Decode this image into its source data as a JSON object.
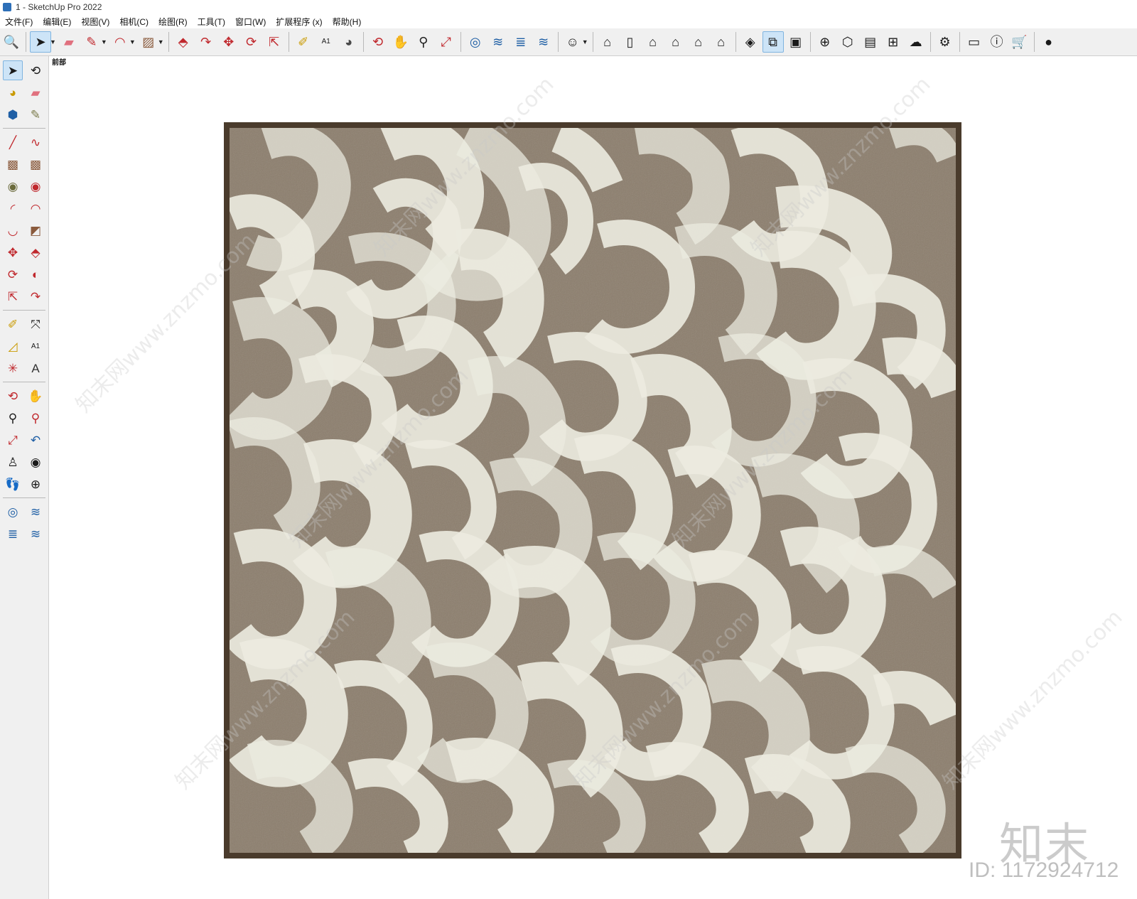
{
  "window": {
    "title": "1 - SketchUp Pro 2022"
  },
  "menu": [
    "文件(F)",
    "编辑(E)",
    "视图(V)",
    "相机(C)",
    "绘图(R)",
    "工具(T)",
    "窗口(W)",
    "扩展程序 (x)",
    "帮助(H)"
  ],
  "toolbar": {
    "groups": [
      [
        {
          "name": "search",
          "glyph": "🔍"
        }
      ],
      [
        {
          "name": "select",
          "glyph": "➤",
          "active": true,
          "dropdown": true
        },
        {
          "name": "eraser",
          "glyph": "▰",
          "color": "#e0707e"
        },
        {
          "name": "pencil-line",
          "glyph": "✎",
          "color": "#c0282d",
          "dropdown": true
        },
        {
          "name": "arc",
          "glyph": "◠",
          "color": "#c0282d",
          "dropdown": true
        },
        {
          "name": "rectangle",
          "glyph": "▨",
          "color": "#8a5a3c",
          "dropdown": true
        }
      ],
      [
        {
          "name": "push-pull",
          "glyph": "⬘",
          "color": "#c0282d"
        },
        {
          "name": "follow-me",
          "glyph": "↷",
          "color": "#c0282d"
        },
        {
          "name": "move",
          "glyph": "✥",
          "color": "#c0282d"
        },
        {
          "name": "rotate",
          "glyph": "⟳",
          "color": "#c0282d"
        },
        {
          "name": "scale",
          "glyph": "⇱",
          "color": "#c0282d"
        }
      ],
      [
        {
          "name": "tape-measure",
          "glyph": "✐",
          "color": "#c99a00"
        },
        {
          "name": "text-label",
          "glyph": "A1"
        },
        {
          "name": "paint-bucket",
          "glyph": "◕",
          "color": "#4a4a4a"
        }
      ],
      [
        {
          "name": "orbit",
          "glyph": "⟲",
          "color": "#c0282d"
        },
        {
          "name": "pan",
          "glyph": "✋",
          "color": "#e0a46c"
        },
        {
          "name": "zoom",
          "glyph": "⚲",
          "color": "#222"
        },
        {
          "name": "zoom-extents",
          "glyph": "⤢",
          "color": "#c0282d"
        }
      ],
      [
        {
          "name": "warehouse",
          "glyph": "◎",
          "color": "#1f5fa5"
        },
        {
          "name": "extension-warehouse",
          "glyph": "≋",
          "color": "#1f5fa5"
        },
        {
          "name": "layout",
          "glyph": "≣",
          "color": "#1f5fa5"
        },
        {
          "name": "extension-manager",
          "glyph": "≋",
          "color": "#1f5fa5"
        }
      ],
      [
        {
          "name": "account",
          "glyph": "☺",
          "dropdown": true
        }
      ],
      [
        {
          "name": "iso-view",
          "glyph": "⌂"
        },
        {
          "name": "top-view",
          "glyph": "▯"
        },
        {
          "name": "front-view",
          "glyph": "⌂"
        },
        {
          "name": "right-view",
          "glyph": "⌂"
        },
        {
          "name": "back-view",
          "glyph": "⌂"
        },
        {
          "name": "left-view",
          "glyph": "⌂"
        }
      ],
      [
        {
          "name": "x-ray",
          "glyph": "◈"
        },
        {
          "name": "section-plane",
          "glyph": "⧉",
          "active": true
        },
        {
          "name": "section-display",
          "glyph": "▣"
        }
      ],
      [
        {
          "name": "add-location",
          "glyph": "⊕"
        },
        {
          "name": "shadow",
          "glyph": "⬡"
        },
        {
          "name": "styles",
          "glyph": "▤"
        },
        {
          "name": "fog",
          "glyph": "⊞"
        },
        {
          "name": "cloud-upload",
          "glyph": "☁"
        }
      ],
      [
        {
          "name": "settings",
          "glyph": "⚙"
        }
      ],
      [
        {
          "name": "feedback",
          "glyph": "▭"
        },
        {
          "name": "info",
          "glyph": "ⓘ"
        },
        {
          "name": "cart",
          "glyph": "🛒"
        }
      ],
      [
        {
          "name": "profile",
          "glyph": "●"
        }
      ]
    ]
  },
  "left_toolbar": [
    [
      {
        "name": "select",
        "glyph": "➤",
        "active": true
      },
      {
        "name": "orbit",
        "glyph": "⟲"
      }
    ],
    [
      {
        "name": "paint-bucket",
        "glyph": "◕",
        "color": "#c99a00"
      },
      {
        "name": "eraser",
        "glyph": "▰",
        "color": "#e0707e"
      }
    ],
    [
      {
        "name": "component",
        "glyph": "⬢",
        "color": "#1f5fa5"
      },
      {
        "name": "sandbox",
        "glyph": "✎",
        "color": "#7a7a4a"
      }
    ],
    [
      {
        "name": "line",
        "glyph": "╱",
        "color": "#c0282d"
      },
      {
        "name": "freehand",
        "glyph": "∿",
        "color": "#c0282d"
      }
    ],
    [
      {
        "name": "rectangle",
        "glyph": "▩",
        "color": "#8a5a3c"
      },
      {
        "name": "rotated-rectangle",
        "glyph": "▩",
        "color": "#8a5a3c"
      }
    ],
    [
      {
        "name": "circle",
        "glyph": "◉",
        "color": "#6b6b3c"
      },
      {
        "name": "polygon",
        "glyph": "◉",
        "color": "#c0282d"
      }
    ],
    [
      {
        "name": "arc",
        "glyph": "◜",
        "color": "#c0282d"
      },
      {
        "name": "2pt-arc",
        "glyph": "◠",
        "color": "#c0282d"
      }
    ],
    [
      {
        "name": "3pt-arc",
        "glyph": "◡",
        "color": "#c0282d"
      },
      {
        "name": "pie",
        "glyph": "◩",
        "color": "#8a5a3c"
      }
    ],
    [
      {
        "name": "move",
        "glyph": "✥",
        "color": "#c0282d"
      },
      {
        "name": "push-pull",
        "glyph": "⬘",
        "color": "#c0282d"
      }
    ],
    [
      {
        "name": "rotate",
        "glyph": "⟳",
        "color": "#c0282d"
      },
      {
        "name": "follow-me",
        "glyph": "◐",
        "color": "#c0282d"
      }
    ],
    [
      {
        "name": "scale",
        "glyph": "⇱",
        "color": "#c0282d"
      },
      {
        "name": "offset",
        "glyph": "↷",
        "color": "#c0282d"
      }
    ],
    [
      {
        "name": "tape-measure",
        "glyph": "✐",
        "color": "#c99a00"
      },
      {
        "name": "dimension",
        "glyph": "⤧"
      }
    ],
    [
      {
        "name": "protractor",
        "glyph": "◿",
        "color": "#c99a00"
      },
      {
        "name": "text",
        "glyph": "A1"
      }
    ],
    [
      {
        "name": "axes",
        "glyph": "✳",
        "color": "#c0282d"
      },
      {
        "name": "3d-text",
        "glyph": "A",
        "color": "#333"
      }
    ],
    [
      {
        "name": "orbit-2",
        "glyph": "⟲",
        "color": "#c0282d"
      },
      {
        "name": "pan",
        "glyph": "✋",
        "color": "#e0a46c"
      }
    ],
    [
      {
        "name": "zoom",
        "glyph": "⚲"
      },
      {
        "name": "zoom-window",
        "glyph": "⚲",
        "color": "#c0282d"
      }
    ],
    [
      {
        "name": "zoom-extents",
        "glyph": "⤢",
        "color": "#c0282d"
      },
      {
        "name": "previous-view",
        "glyph": "↶",
        "color": "#1f5fa5"
      }
    ],
    [
      {
        "name": "position-camera",
        "glyph": "♙"
      },
      {
        "name": "look-around",
        "glyph": "◉"
      }
    ],
    [
      {
        "name": "walk",
        "glyph": "👣"
      },
      {
        "name": "section-plane",
        "glyph": "⊕"
      }
    ],
    [
      {
        "name": "warehouse",
        "glyph": "◎",
        "color": "#1f5fa5"
      },
      {
        "name": "extension-warehouse",
        "glyph": "≋",
        "color": "#1f5fa5"
      }
    ],
    [
      {
        "name": "layout",
        "glyph": "≣",
        "color": "#1f5fa5"
      },
      {
        "name": "extension-manager",
        "glyph": "≋",
        "color": "#1f5fa5"
      }
    ]
  ],
  "viewport": {
    "view_label": "前部",
    "artwork": {
      "frame_color": "#4a3b2c",
      "canvas_color": "#8c7e6d",
      "stroke_color": "#ecebe0"
    }
  },
  "watermarks": {
    "logo": "知末",
    "id_text": "ID: 1172924712",
    "diagonal": "知末网www.znzmo.com"
  }
}
